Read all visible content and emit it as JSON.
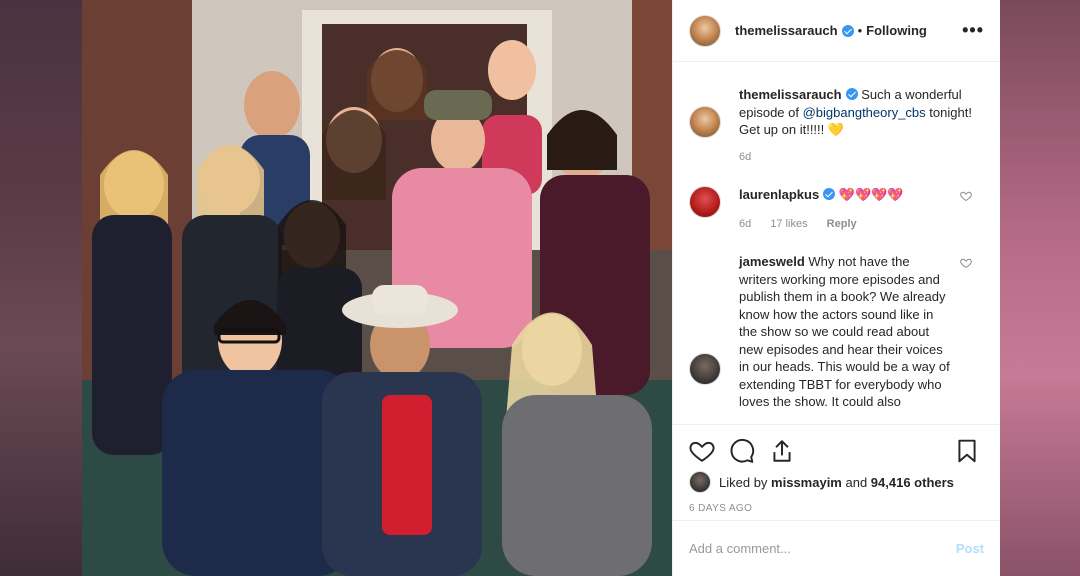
{
  "post": {
    "author": "themelissarauch",
    "follow_separator": "•",
    "follow_status": "Following",
    "more_glyph": "•••",
    "caption": {
      "username": "themelissarauch",
      "text_before": " Such a wonderful episode of ",
      "mention": "@bigbangtheory_cbs",
      "text_after": " tonight! Get up on it!!!!! ",
      "emoji": "💛",
      "age": "6d"
    },
    "comments": [
      {
        "username": "laurenlapkus",
        "verified": true,
        "text": "💖💖💖💖",
        "age": "6d",
        "likes": "17 likes",
        "reply": "Reply"
      },
      {
        "username": "jamesweld",
        "verified": false,
        "text": " Why not have the writers working more episodes and publish them in a book? We already know how the actors sound like in the show so we could read about new episodes and hear their voices in our heads. This would be a way of extending TBBT for everybody who loves the show. It could also"
      }
    ],
    "liked_by_prefix": "Liked by ",
    "liked_by_user": "missmayim",
    "liked_by_and": " and ",
    "liked_by_others": "94,416 others",
    "time_ago": "6 DAYS AGO",
    "add_comment_placeholder": "Add a comment...",
    "post_label": "Post"
  },
  "colors": {
    "link": "#00376b",
    "verified": "#3897f0",
    "muted": "#8e8e8e",
    "post_disabled": "#b2dffc"
  },
  "icons": [
    "heart-icon",
    "comment-icon",
    "share-icon",
    "bookmark-icon",
    "more-icon",
    "verified-icon"
  ]
}
